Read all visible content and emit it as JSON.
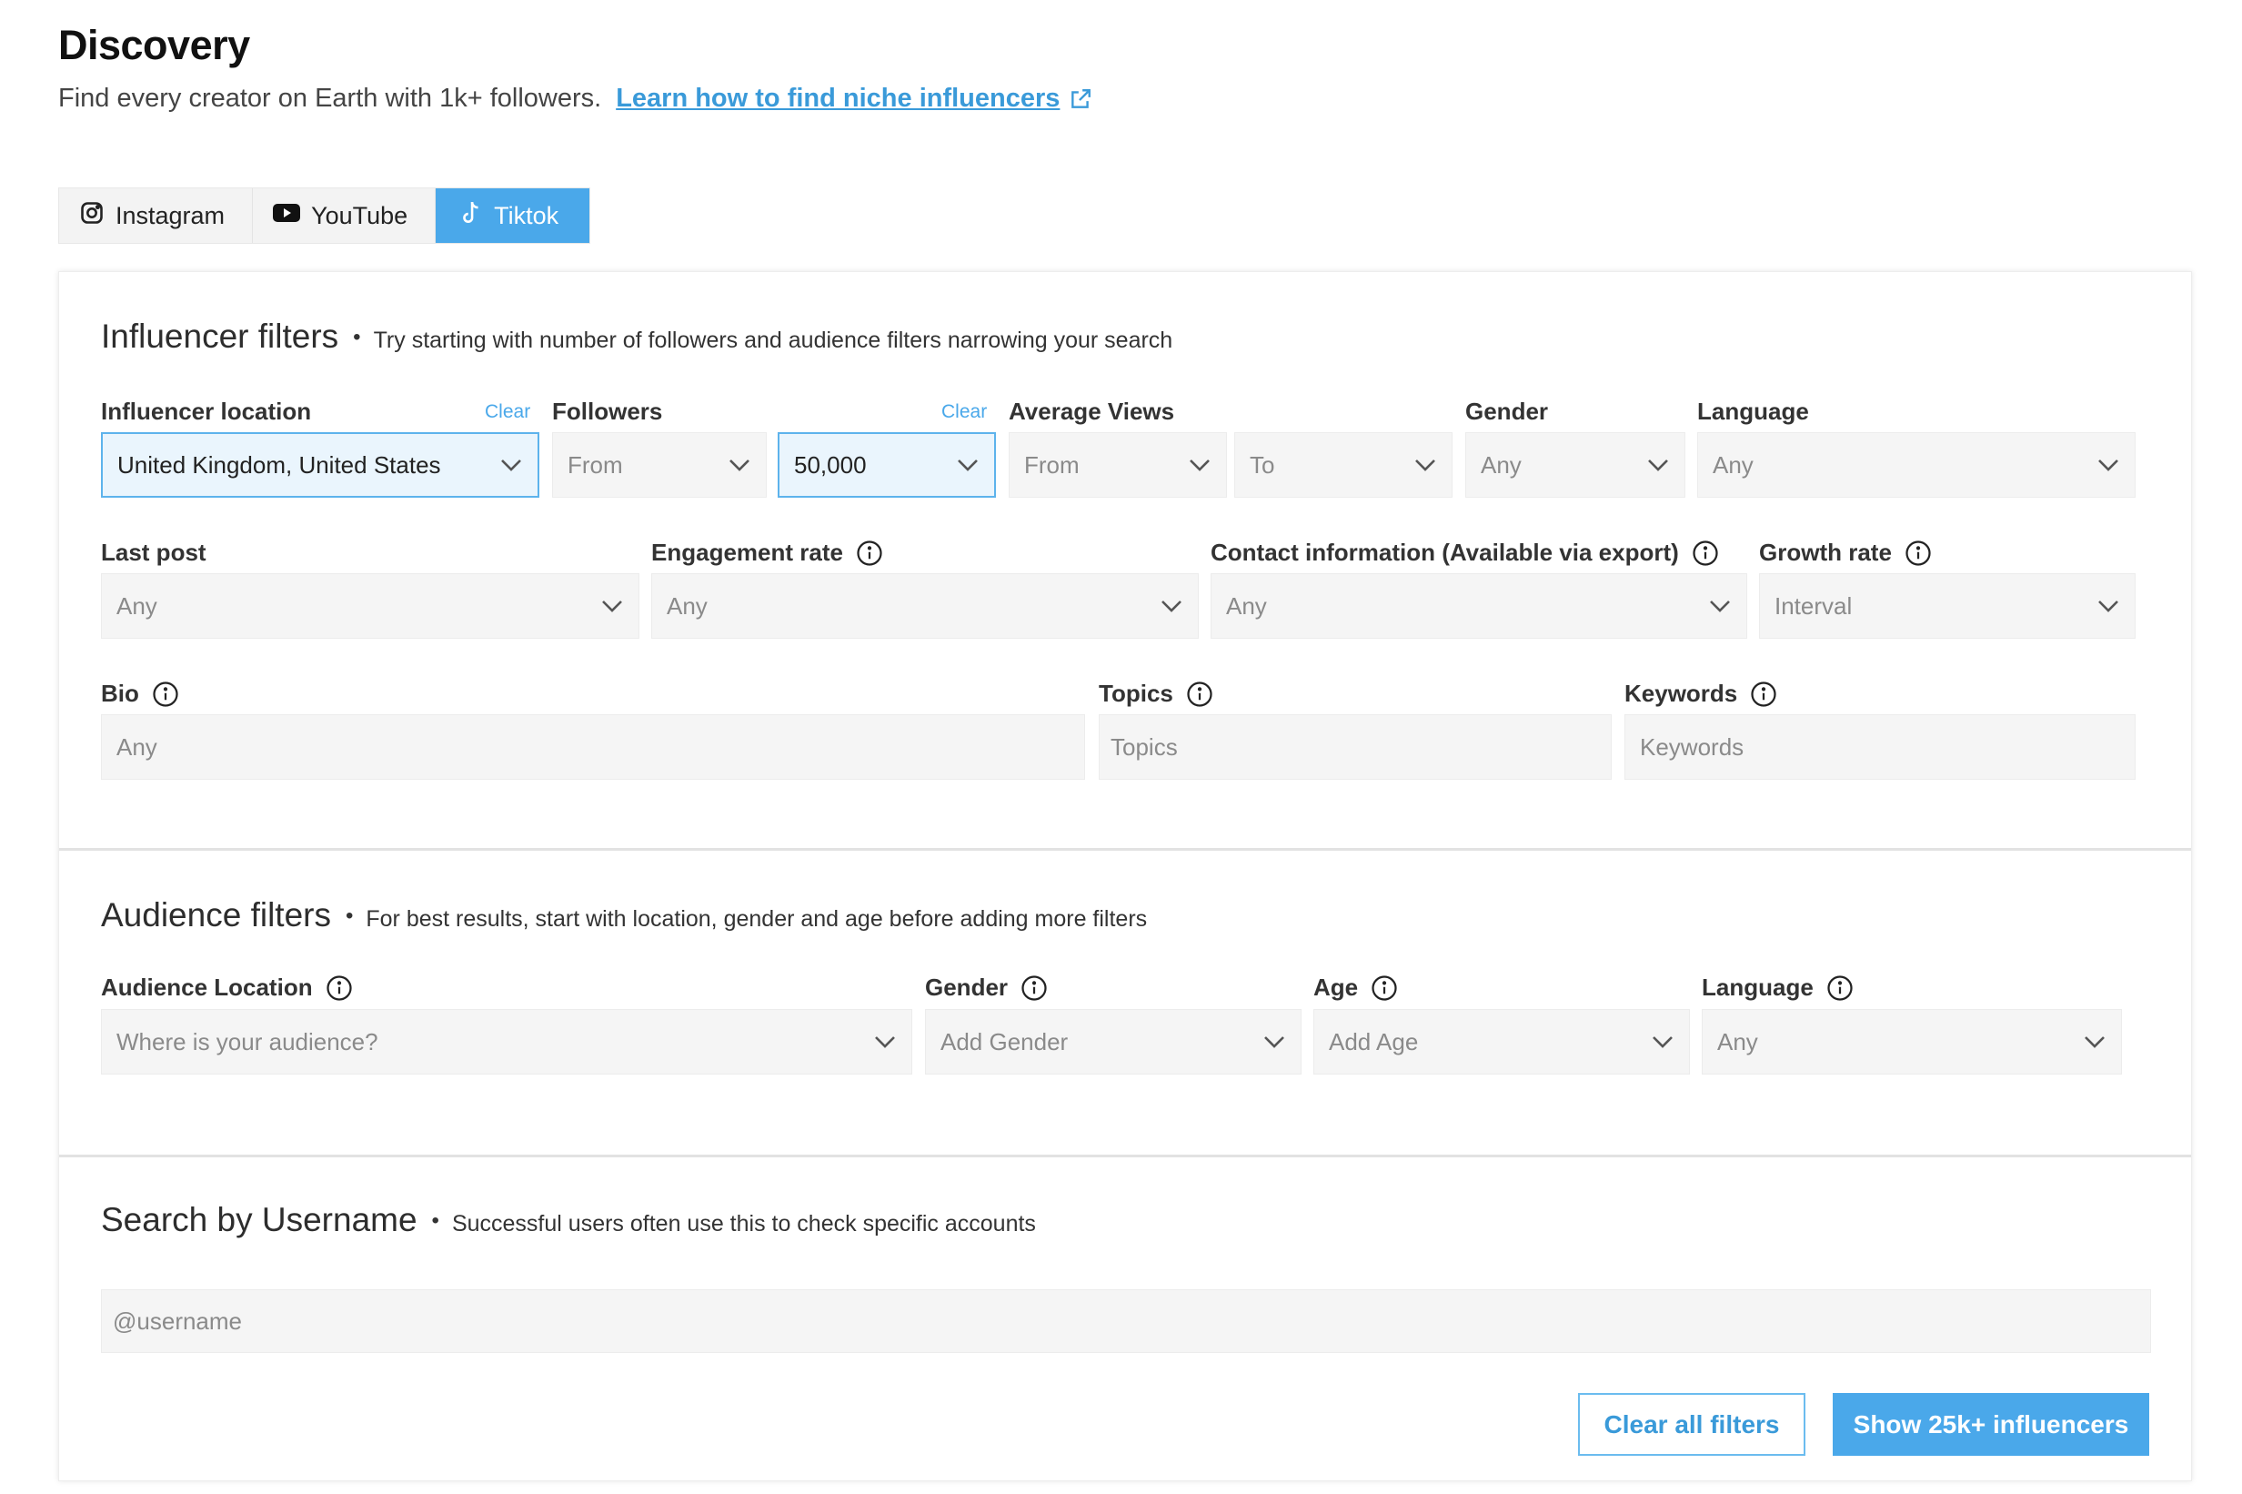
{
  "page": {
    "title": "Discovery",
    "subtitle": "Find every creator on Earth with 1k+ followers.",
    "learn_link": "Learn how to find niche influencers"
  },
  "tabs": [
    {
      "label": "Instagram",
      "icon": "instagram-icon",
      "active": false
    },
    {
      "label": "YouTube",
      "icon": "youtube-icon",
      "active": false
    },
    {
      "label": "Tiktok",
      "icon": "tiktok-icon",
      "active": true
    }
  ],
  "influencer_filters": {
    "title": "Influencer filters",
    "hint": "Try starting with number of followers and audience filters narrowing your search",
    "clear_label": "Clear",
    "location": {
      "label": "Influencer location",
      "value": "United Kingdom, United States"
    },
    "followers": {
      "label": "Followers",
      "from": "From",
      "to": "50,000"
    },
    "average_views": {
      "label": "Average Views",
      "from": "From",
      "to": "To"
    },
    "gender": {
      "label": "Gender",
      "value": "Any"
    },
    "language": {
      "label": "Language",
      "value": "Any"
    },
    "last_post": {
      "label": "Last post",
      "value": "Any"
    },
    "engagement_rate": {
      "label": "Engagement rate",
      "value": "Any"
    },
    "contact_info": {
      "label": "Contact information (Available via export)",
      "value": "Any"
    },
    "growth_rate": {
      "label": "Growth rate",
      "value": "Interval"
    },
    "bio": {
      "label": "Bio",
      "placeholder": "Any"
    },
    "topics": {
      "label": "Topics",
      "placeholder": "Topics"
    },
    "keywords": {
      "label": "Keywords",
      "placeholder": "Keywords"
    }
  },
  "audience_filters": {
    "title": "Audience filters",
    "hint": "For best results, start with location, gender and age before adding more filters",
    "location": {
      "label": "Audience Location",
      "placeholder": "Where is your audience?"
    },
    "gender": {
      "label": "Gender",
      "placeholder": "Add Gender"
    },
    "age": {
      "label": "Age",
      "placeholder": "Add Age"
    },
    "language": {
      "label": "Language",
      "value": "Any"
    }
  },
  "username_search": {
    "title": "Search by Username",
    "hint": "Successful users often use this to check specific accounts",
    "placeholder": "@username"
  },
  "actions": {
    "clear_all": "Clear all filters",
    "show": "Show 25k+ influencers"
  },
  "colors": {
    "accent": "#4aa8ea",
    "link": "#3a9ad9",
    "field_bg": "#f5f5f5",
    "active_field_bg": "#eaf5fd"
  }
}
